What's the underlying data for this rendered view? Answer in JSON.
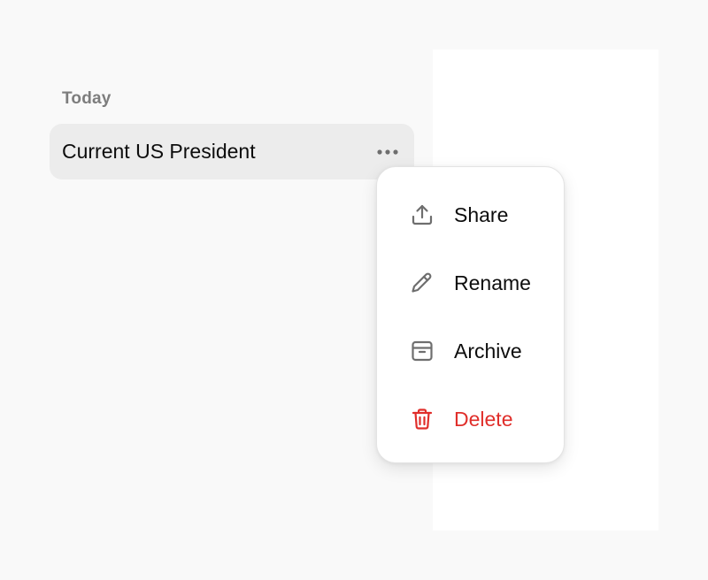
{
  "sidebar": {
    "section_label": "Today",
    "chats": [
      {
        "title": "Current US President"
      }
    ],
    "more_icon": "ellipsis-icon"
  },
  "context_menu": {
    "items": [
      {
        "label": "Share",
        "icon": "share-icon"
      },
      {
        "label": "Rename",
        "icon": "pencil-icon"
      },
      {
        "label": "Archive",
        "icon": "archive-icon"
      },
      {
        "label": "Delete",
        "icon": "trash-icon",
        "color": "#e02e2a"
      }
    ]
  },
  "colors": {
    "background": "#f9f9f9",
    "selected_item": "#ececec",
    "danger": "#e02e2a",
    "icon_gray": "#6e6e6e"
  }
}
